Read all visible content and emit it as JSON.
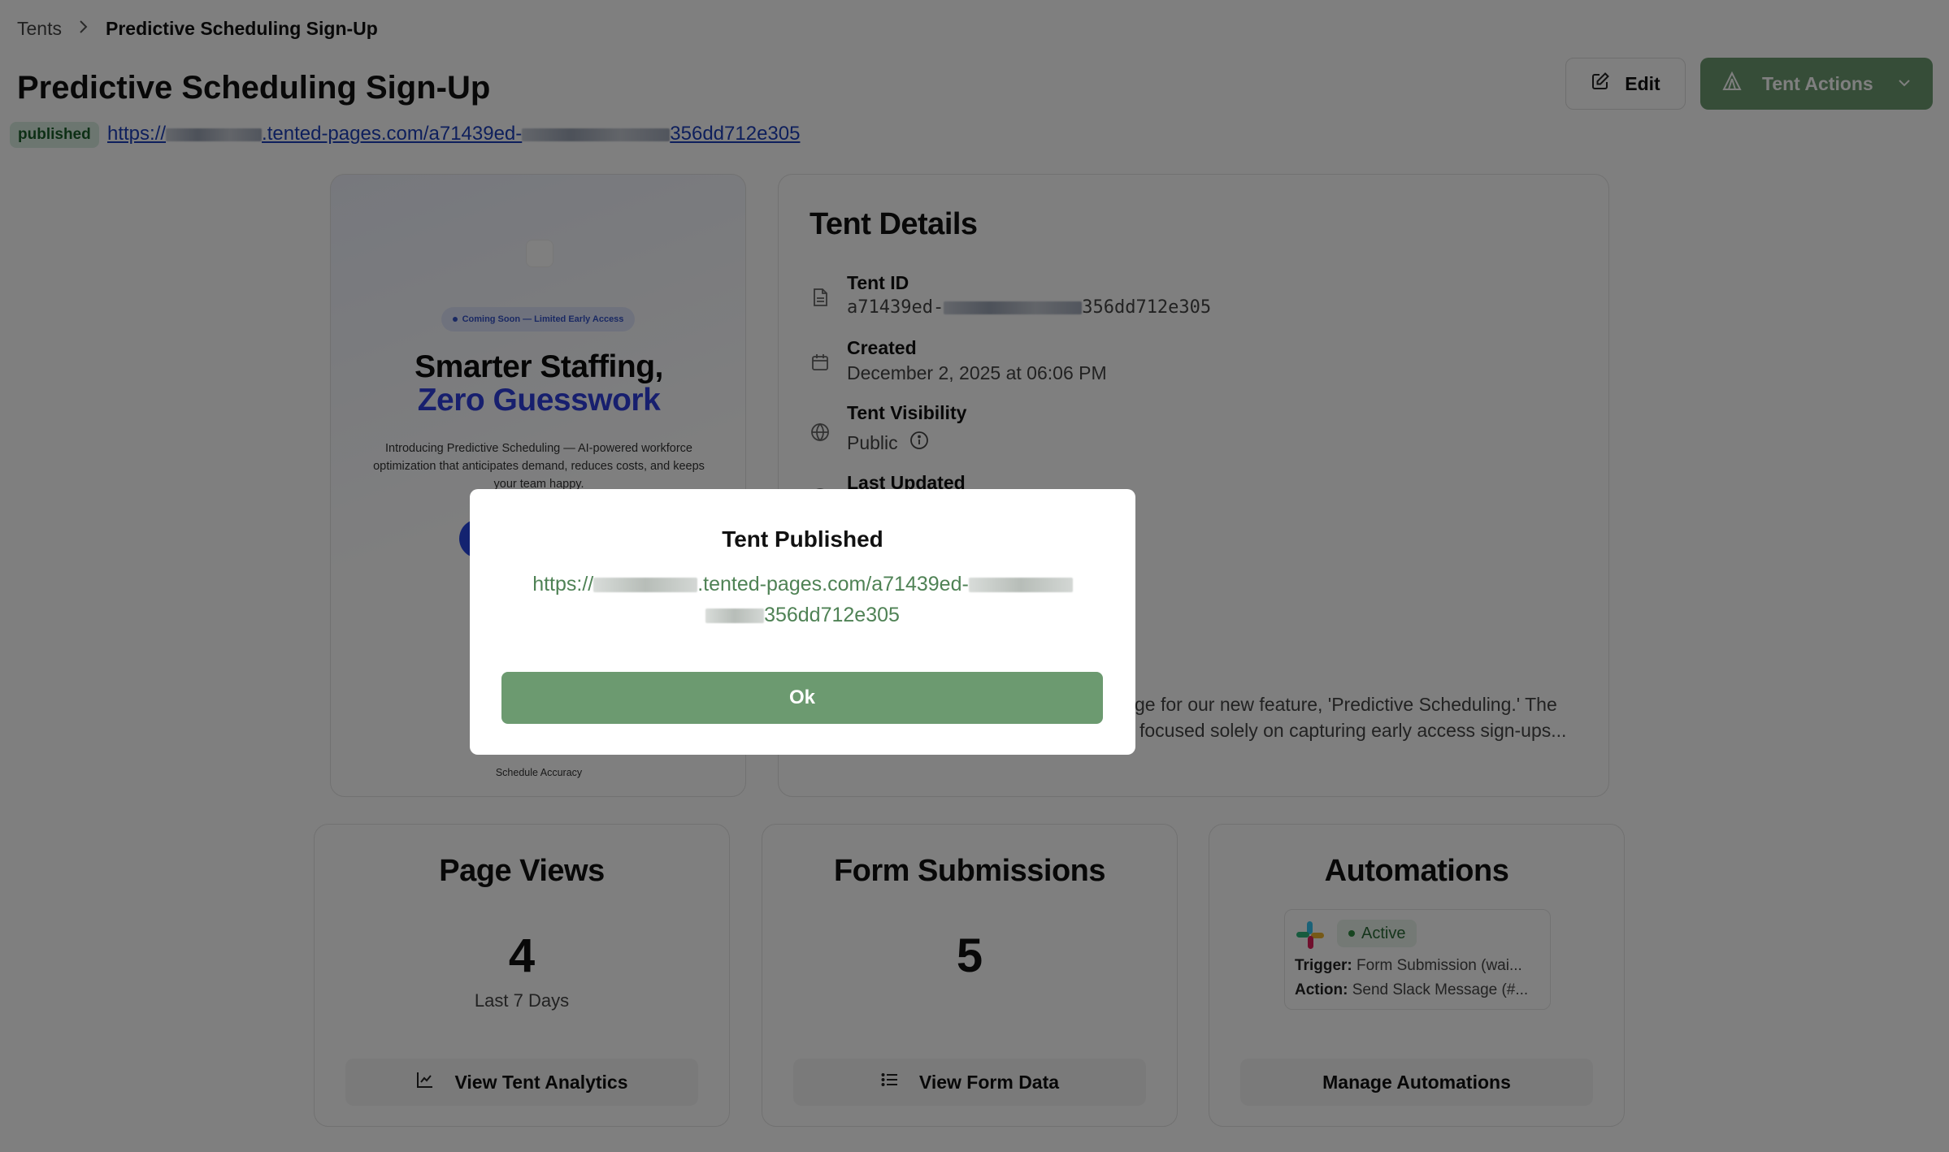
{
  "breadcrumb": {
    "root": "Tents",
    "separator": "›",
    "current": "Predictive Scheduling Sign-Up"
  },
  "header": {
    "title": "Predictive Scheduling Sign-Up",
    "status": "published",
    "url_prefix": "https://",
    "url_middle": ".tented-pages.com/a71439ed-",
    "url_suffix": "356dd712e305",
    "edit_label": "Edit",
    "actions_label": "Tent Actions"
  },
  "preview": {
    "pill": "Coming Soon — Limited Early Access",
    "headline_1": "Smarter Staffing,",
    "headline_2": "Zero Guesswork",
    "description": "Introducing Predictive Scheduling — AI-powered workforce optimization that anticipates demand, reduces costs, and keeps your team happy.",
    "footer": "Schedule Accuracy"
  },
  "details": {
    "title": "Tent Details",
    "id_label": "Tent ID",
    "id_prefix": "a71439ed-",
    "id_suffix": "356dd712e305",
    "created_label": "Created",
    "created_value": "December 2, 2025 at 06:06 PM",
    "visibility_label": "Tent Visibility",
    "visibility_value": "Public",
    "updated_label": "Last Updated",
    "description_line_1": "ge for our new feature, 'Predictive Scheduling.' The",
    "description_line_2": "focused solely on capturing early access sign-ups..."
  },
  "stats": {
    "views": {
      "title": "Page Views",
      "value": "4",
      "sub": "Last 7 Days",
      "button": "View Tent Analytics"
    },
    "forms": {
      "title": "Form Submissions",
      "value": "5",
      "button": "View Form Data"
    },
    "automations": {
      "title": "Automations",
      "status": "Active",
      "trigger_label": "Trigger:",
      "trigger_value": "Form Submission (wai...",
      "action_label": "Action:",
      "action_value": "Send Slack Message (#...",
      "button": "Manage Automations"
    }
  },
  "modal": {
    "title": "Tent Published",
    "url_prefix": "https://",
    "url_middle": ".tented-pages.com/a71439ed-",
    "url_suffix": "356dd712e305",
    "ok_label": "Ok"
  },
  "colors": {
    "accent_green": "#6c9a70",
    "link_blue": "#1d3fb8",
    "badge_bg": "#d9ede0"
  }
}
